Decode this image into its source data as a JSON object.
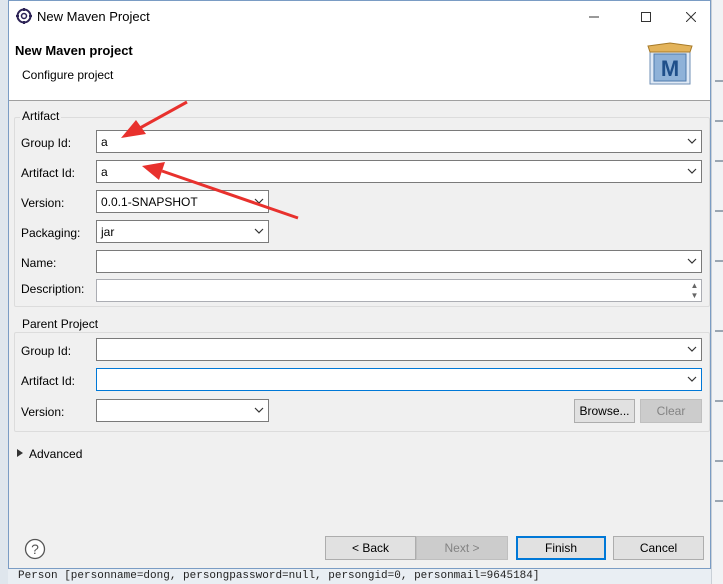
{
  "window": {
    "title": "New Maven Project",
    "minimize_icon": "minimize-icon",
    "maximize_icon": "maximize-icon",
    "close_icon": "close-icon"
  },
  "header": {
    "title": "New Maven project",
    "subtitle": "Configure project",
    "logo_letter": "M"
  },
  "artifact": {
    "group_label": "Artifact",
    "group_id_label": "Group Id:",
    "group_id_value": "a",
    "artifact_id_label": "Artifact Id:",
    "artifact_id_value": "a",
    "version_label": "Version:",
    "version_value": "0.0.1-SNAPSHOT",
    "packaging_label": "Packaging:",
    "packaging_value": "jar",
    "name_label": "Name:",
    "name_value": "",
    "description_label": "Description:",
    "description_value": ""
  },
  "parent": {
    "group_label": "Parent Project",
    "group_id_label": "Group Id:",
    "group_id_value": "",
    "artifact_id_label": "Artifact Id:",
    "artifact_id_value": "",
    "version_label": "Version:",
    "version_value": "",
    "browse_label": "Browse...",
    "clear_label": "Clear"
  },
  "advanced": {
    "label": "Advanced"
  },
  "footer": {
    "back_label": "< Back",
    "next_label": "Next >",
    "finish_label": "Finish",
    "cancel_label": "Cancel"
  },
  "console": {
    "line": "Person [personname=dong, persongpassword=null, persongid=0, personmail=9645184]"
  },
  "colors": {
    "accent": "#0078d7",
    "annotation_arrow": "#e8312d"
  }
}
